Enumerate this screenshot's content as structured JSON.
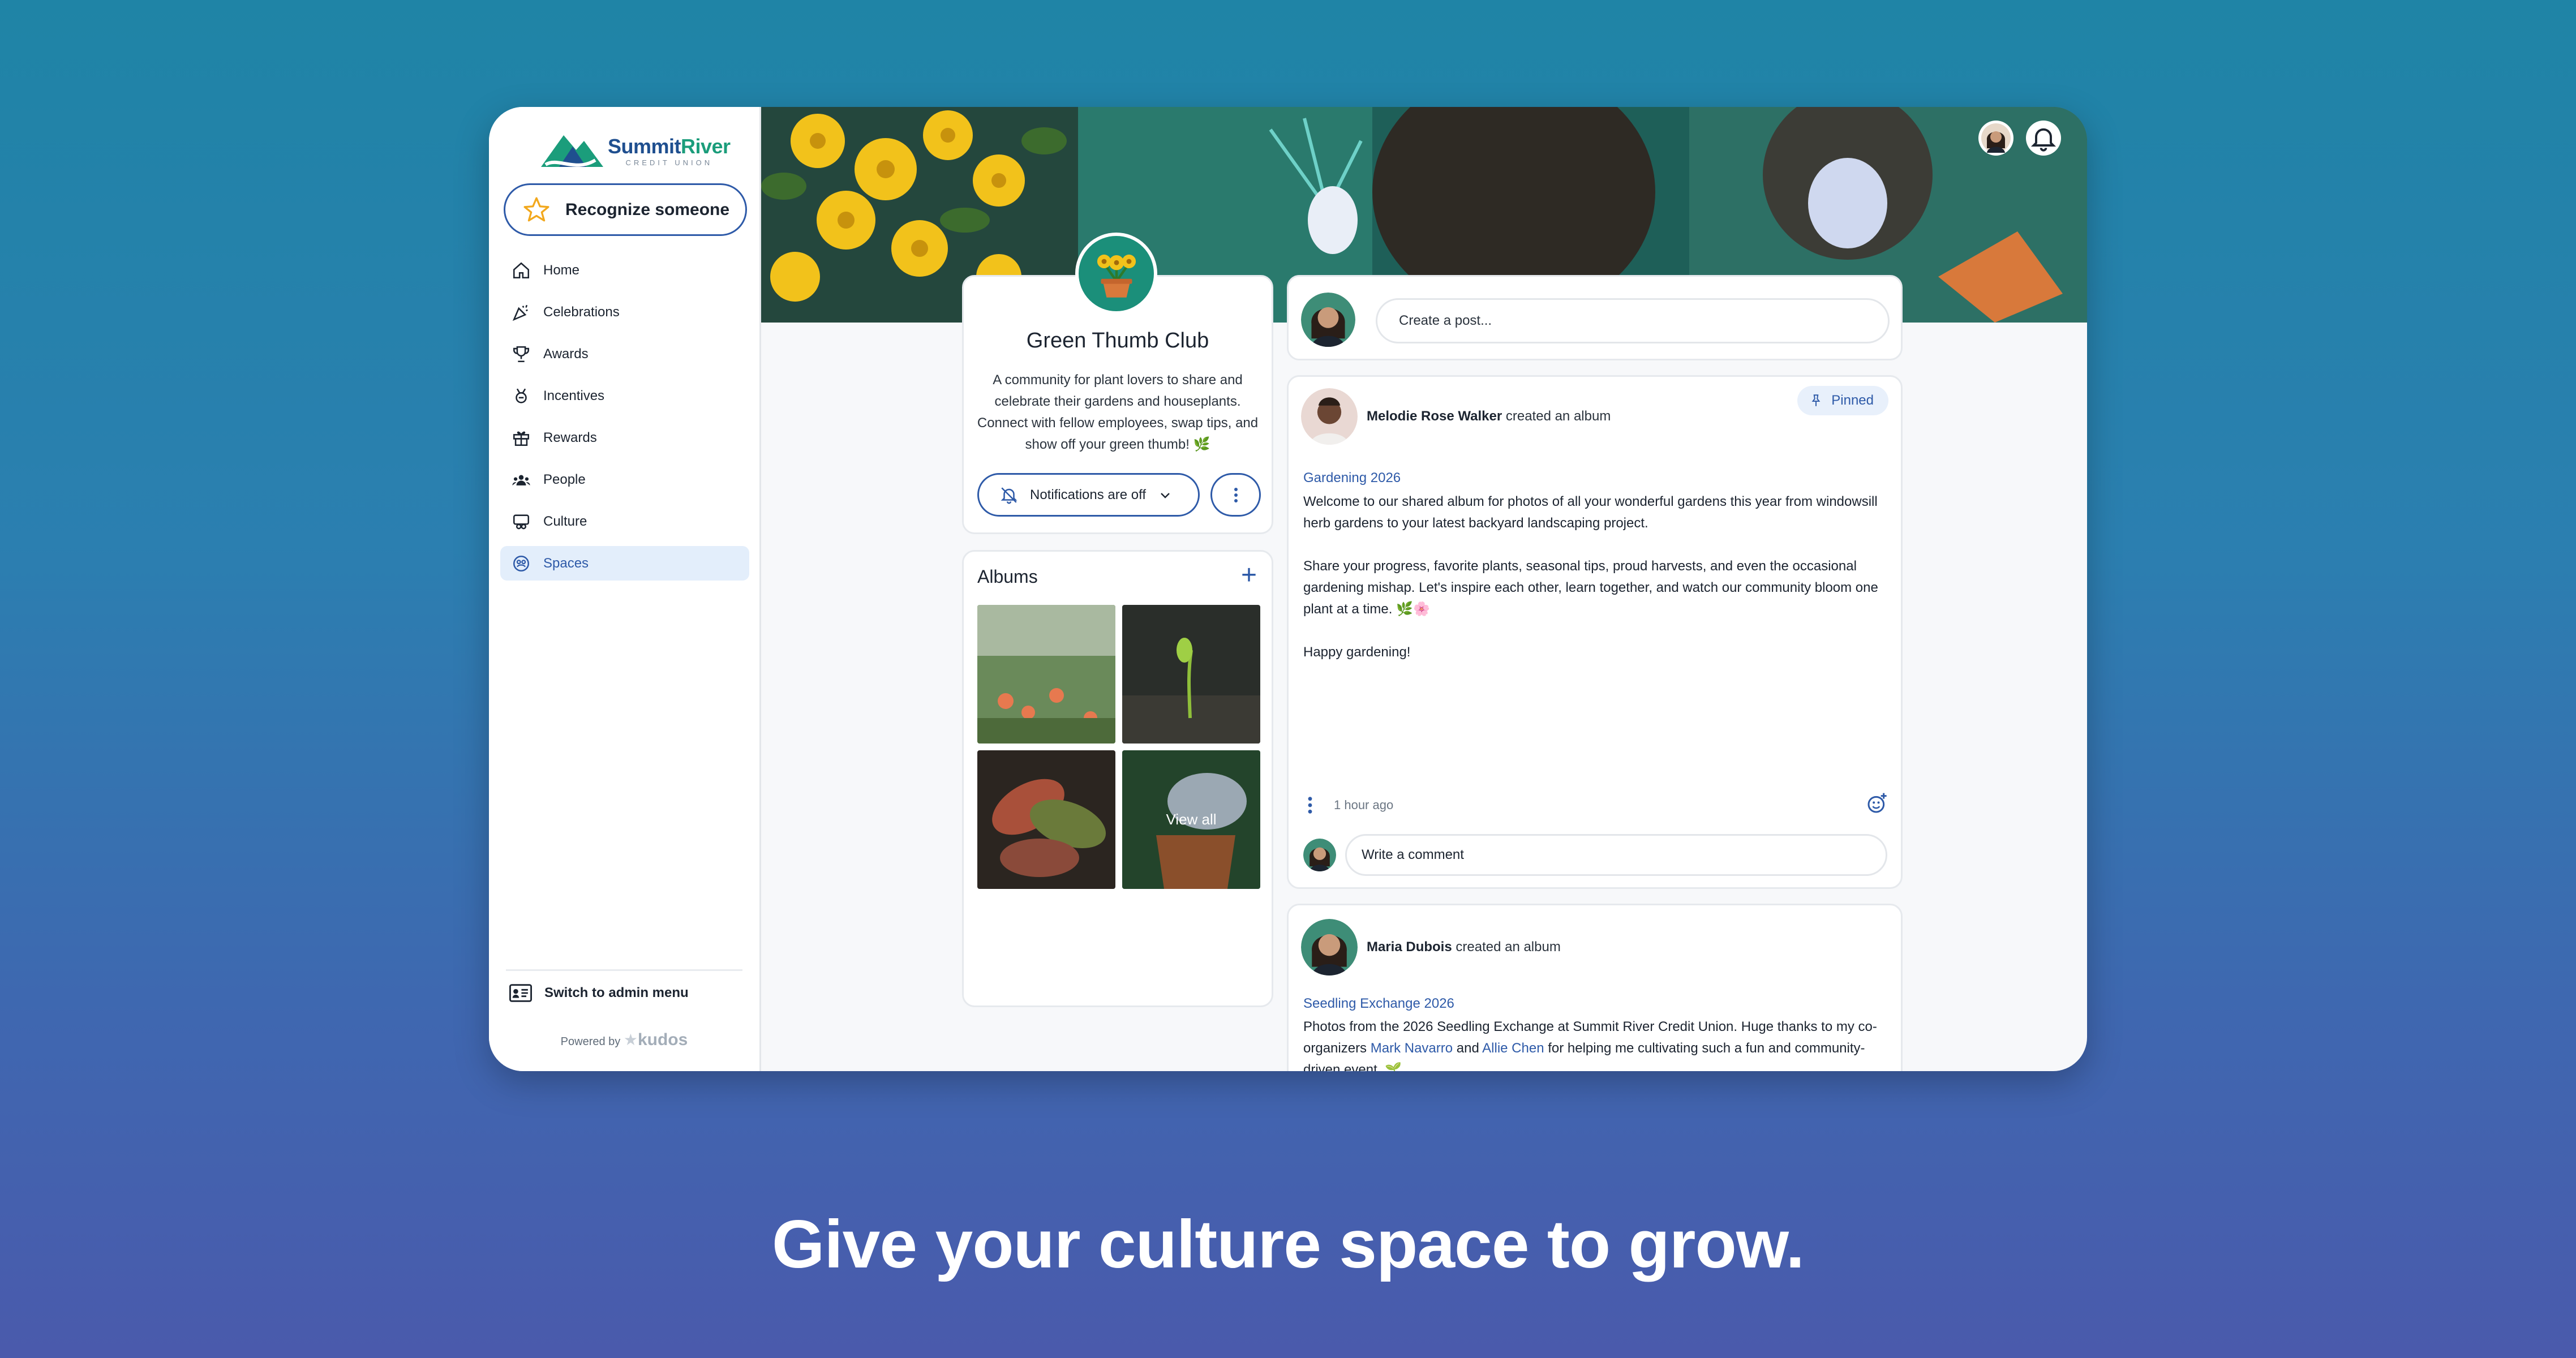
{
  "brand": {
    "name_part1": "Summit",
    "name_part2": "River",
    "subtitle": "CREDIT UNION",
    "accent": "#2e5aa8",
    "green": "#1b9d7b"
  },
  "sidebar": {
    "recognize_label": "Recognize someone",
    "items": [
      {
        "label": "Home",
        "icon": "home-icon"
      },
      {
        "label": "Celebrations",
        "icon": "party-popper-icon"
      },
      {
        "label": "Awards",
        "icon": "trophy-icon"
      },
      {
        "label": "Incentives",
        "icon": "incentive-icon"
      },
      {
        "label": "Rewards",
        "icon": "gift-icon"
      },
      {
        "label": "People",
        "icon": "people-icon"
      },
      {
        "label": "Culture",
        "icon": "culture-icon"
      },
      {
        "label": "Spaces",
        "icon": "spaces-icon",
        "active": true
      }
    ],
    "admin_label": "Switch to admin menu",
    "powered_by": "Powered by",
    "powered_brand": "kudos"
  },
  "space": {
    "title": "Green Thumb Club",
    "description": "A community for plant lovers to share and celebrate their gardens and houseplants. Connect with fellow employees, swap tips, and show off your green thumb! 🌿",
    "notifications_label": "Notifications are off"
  },
  "albums": {
    "title": "Albums",
    "view_all": "View all"
  },
  "composer": {
    "placeholder": "Create a post..."
  },
  "posts": [
    {
      "author": "Melodie Rose Walker",
      "action": "created an album",
      "pinned_label": "Pinned",
      "album_title": "Gardening 2026",
      "body": [
        "Welcome to our shared album for photos of all your wonderful gardens this year from windowsill herb gardens to your latest backyard landscaping project.",
        "Share your progress, favorite plants, seasonal tips, proud harvests, and even the occasional gardening mishap. Let's inspire each other, learn together, and watch our community bloom one plant at a time. 🌿🌸",
        "Happy gardening!"
      ],
      "time": "1 hour ago",
      "comment_placeholder": "Write a comment"
    },
    {
      "author": "Maria Dubois",
      "action": "created an album",
      "album_title": "Seedling Exchange 2026",
      "body_start": "Photos from the 2026 Seedling Exchange at Summit River Credit Union. Huge thanks to my co-organizers ",
      "mention1": "Mark Navarro",
      "body_and": " and ",
      "mention2": "Allie Chen",
      "body_end": " for helping me cultivating such a fun and community-driven event. 🌱"
    }
  ],
  "tagline": "Give your culture space to grow."
}
